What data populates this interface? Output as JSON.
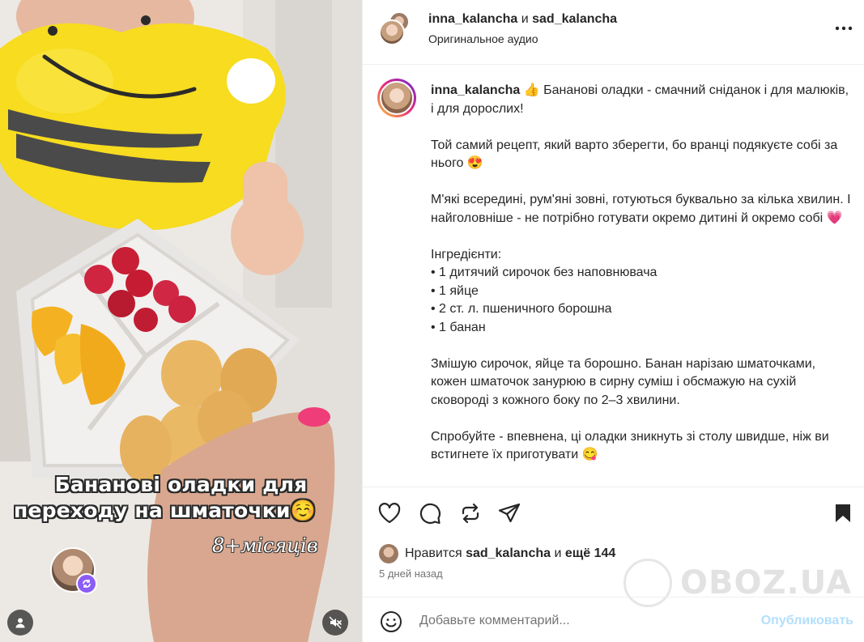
{
  "media": {
    "overlay_title_line1": "Бананові оладки для",
    "overlay_title_line2": "переходу на шматочки☺️",
    "overlay_age": "8+місяців",
    "icons": {
      "remix": "remix-icon",
      "user_tag": "user-tag-icon",
      "mute": "sound-off-icon"
    }
  },
  "header": {
    "user1": "inna_kalancha",
    "conjunction": "и",
    "user2": "sad_kalancha",
    "audio": "Оригинальное аудио",
    "more_icon": "more-options-icon"
  },
  "caption": {
    "username": "inna_kalancha",
    "intro": "👍 Бананові оладки - смачний сніданок і для малюків, і для дорослих!",
    "para2": "Той самий рецепт, який варто зберегти, бо вранці подякуєте собі за нього 😍",
    "para3": "М'які всередині, рум'яні зовні, готуються буквально за кілька хвилин. І найголовніше - не потрібно готувати окремо дитині й окремо собі 💗",
    "ingredients_title": "Інгредієнти:",
    "ingredients": [
      "• 1 дитячий сирочок без наповнювача",
      "• 1 яйце",
      "• 2 ст. л. пшеничного борошна",
      "• 1 банан"
    ],
    "para5": "Змішую сирочок, яйце та борошно. Банан нарізаю шматочками, кожен шматочок занурюю в сирну суміш і обсмажую на сухій сковороді з кожного боку по 2–3 хвилини.",
    "para6": "Спробуйте - впевнена, ці оладки зникнуть зі столу швидше, ніж ви встигнете їх приготувати 😋"
  },
  "actions": {
    "like_icon": "heart-icon",
    "comment_icon": "comment-icon",
    "repost_icon": "repost-icon",
    "share_icon": "share-icon",
    "save_icon": "bookmark-icon"
  },
  "likes": {
    "prefix": "Нравится",
    "user": "sad_kalancha",
    "conjunction": "и",
    "others": "ещё 144"
  },
  "timestamp": "5 дней назад",
  "comment": {
    "placeholder": "Добавьте комментарий...",
    "publish": "Опубликовать"
  },
  "watermark": "OBOZ.UA",
  "colors": {
    "publish_disabled": "#b2dffc",
    "secondary_text": "#737373",
    "border": "#efefef",
    "remix_badge": "#8b5cf6"
  }
}
